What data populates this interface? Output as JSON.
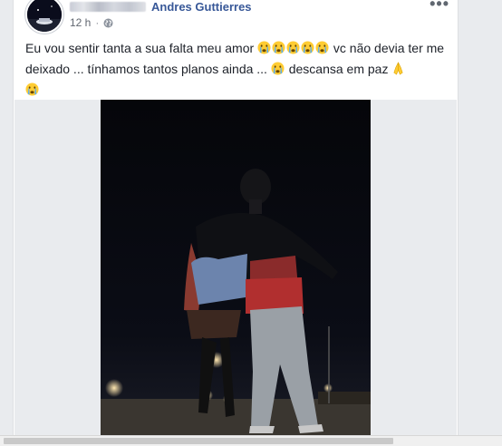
{
  "post": {
    "author_name": "Andres Guttierres",
    "timestamp": "12 h",
    "separator": "·",
    "privacy_icon": "globe-icon",
    "more_label": "•••",
    "text_line1": "Eu vou sentir tanta a sua falta meu amor",
    "text_after_emojis": " vc não devia ter me deixado ... tínhamos tantos planos ainda ...",
    "text_end": " descansa em paz",
    "emojis": [
      "crying-face",
      "crying-face",
      "crying-face",
      "crying-face",
      "crying-face",
      "crying-face",
      "folded-hands",
      "crying-face"
    ]
  },
  "colors": {
    "author_link": "#385898",
    "body_text": "#1d2129",
    "meta_text": "#616770",
    "page_background": "#e9ebee"
  }
}
